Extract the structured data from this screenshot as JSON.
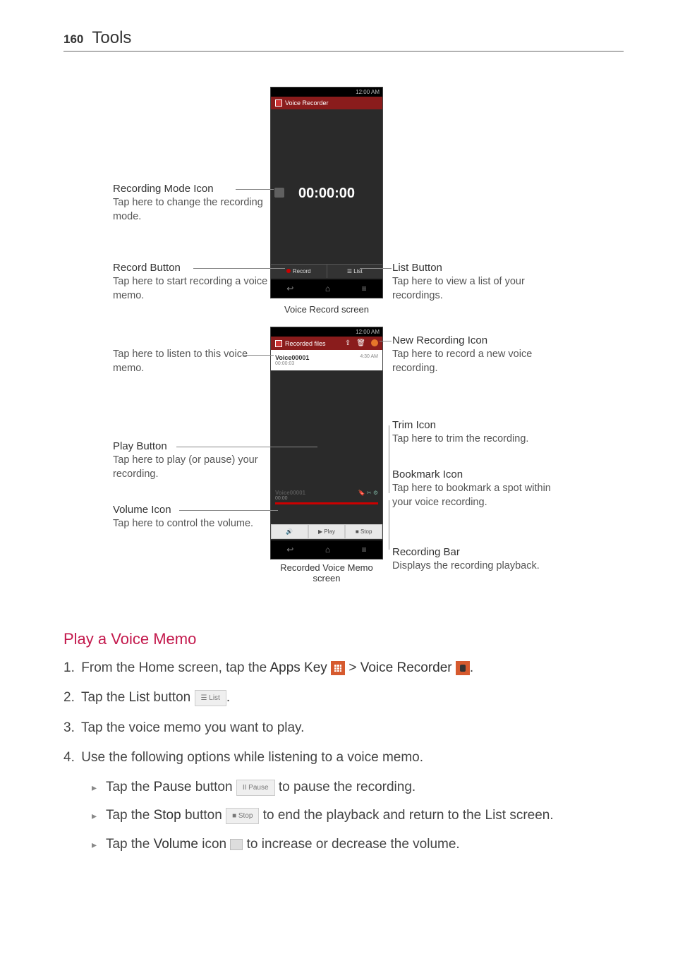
{
  "page_number": "160",
  "section": "Tools",
  "screen1": {
    "status_time": "12:00 AM",
    "title": "Voice Recorder",
    "timer": "00:00:00",
    "record_btn": "Record",
    "list_btn": "List",
    "caption": "Voice Record screen"
  },
  "screen2": {
    "status_time": "12:00 AM",
    "title": "Recorded files",
    "file_name": "Voice00001",
    "file_dur": "00:00:03",
    "file_time": "4:30 AM",
    "player_file": "Voice00001",
    "player_time": "00:00",
    "vol_btn": "",
    "play_btn": "Play",
    "stop_btn": "Stop",
    "caption": "Recorded Voice Memo screen"
  },
  "callouts": {
    "mode_h": "Recording Mode Icon",
    "mode_b": "Tap here to change the recording mode.",
    "record_h": "Record Button",
    "record_b": "Tap here to start recording a voice memo.",
    "list_h": "List Button",
    "list_b": "Tap here to view a list of your recordings.",
    "listen_b": "Tap here to listen to this voice memo.",
    "new_h": "New Recording Icon",
    "new_b": "Tap here to record a new voice recording.",
    "trim_h": "Trim Icon",
    "trim_b": "Tap here to trim the recording.",
    "book_h": "Bookmark Icon",
    "book_b": "Tap here to bookmark a spot within your voice recording.",
    "bar_h": "Recording Bar",
    "bar_b": "Displays the recording playback.",
    "play_h": "Play Button",
    "play_b": "Tap here to play (or pause) your recording.",
    "vol_h": "Volume Icon",
    "vol_b": "Tap here to control the volume."
  },
  "subheading": "Play a Voice Memo",
  "steps": {
    "s1a": "From the Home screen, tap the ",
    "s1b": "Apps Key",
    "s1c": " > ",
    "s1d": "Voice Recorder",
    "s1e": ".",
    "s2a": "Tap the ",
    "s2b": "List",
    "s2c": " button ",
    "s2_btn": "List",
    "s2d": ".",
    "s3": "Tap the voice memo you want to play.",
    "s4": "Use the following options while listening to a voice memo.",
    "b1a": "Tap the ",
    "b1b": "Pause",
    "b1c": " button ",
    "b1_btn": "II Pause",
    "b1d": " to pause the recording.",
    "b2a": "Tap the ",
    "b2b": "Stop",
    "b2c": " button ",
    "b2_btn": "■ Stop",
    "b2d": " to end the playback and return to the List screen.",
    "b3a": "Tap the ",
    "b3b": "Volume",
    "b3c": " icon ",
    "b3d": " to increase or decrease the volume."
  }
}
